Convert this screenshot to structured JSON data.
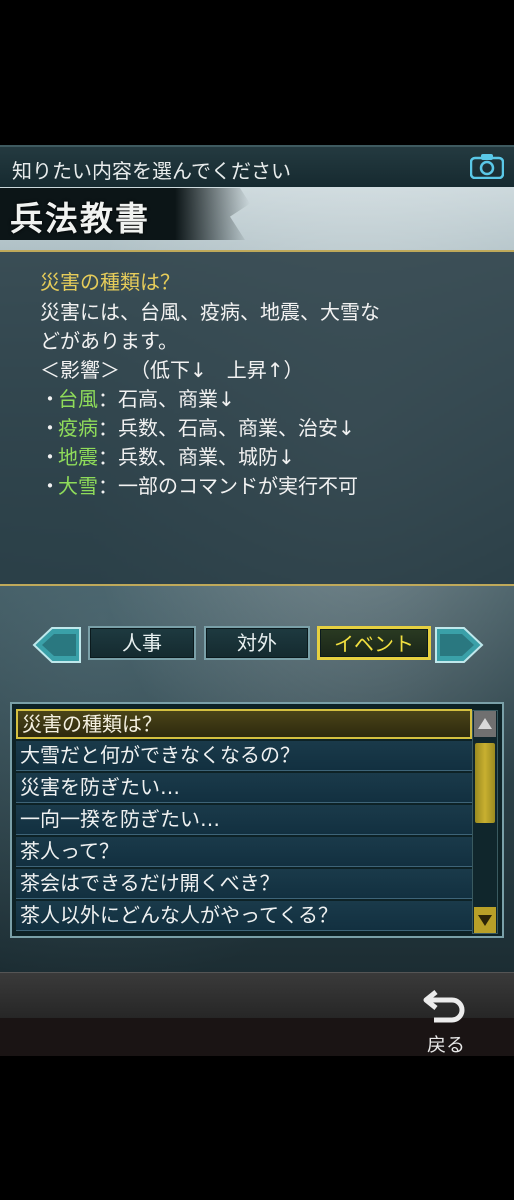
{
  "header": {
    "prompt": "知りたい内容を選んでください",
    "camera_icon": "camera-icon"
  },
  "title": "兵法教書",
  "info": {
    "question": "災害の種類は？",
    "body_line1": "災害には、台風、疫病、地震、大雪な",
    "body_line2": "どがあります。",
    "effect_line": "＜影響＞　（低下↓　上昇↑）",
    "bullets": [
      {
        "name": "台風",
        "desc": "：石高、商業↓"
      },
      {
        "name": "疫病",
        "desc": "：兵数、石高、商業、治安↓"
      },
      {
        "name": "地震",
        "desc": "：兵数、商業、城防↓"
      },
      {
        "name": "大雪",
        "desc": "：一部のコマンドが実行不可"
      }
    ],
    "bullet_mark": "・"
  },
  "tabs": [
    {
      "label": "人事"
    },
    {
      "label": "対外"
    },
    {
      "label": "イベント",
      "active": true
    }
  ],
  "questions": [
    "災害の種類は？",
    "大雪だと何ができなくなるの？",
    "災害を防ぎたい…",
    "一向一揆を防ぎたい…",
    "茶人って？",
    "茶会はできるだけ開くべき？",
    "茶人以外にどんな人がやってくる？"
  ],
  "back_label": "戻る",
  "colors": {
    "accent_gold": "#e6d040",
    "highlight_green": "#8fdc5a",
    "question_gold": "#e6cc5a"
  }
}
